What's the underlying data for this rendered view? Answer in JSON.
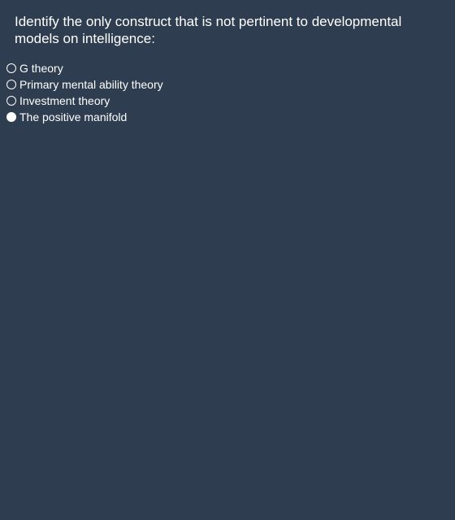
{
  "question": {
    "text": "Identify the only construct that is not pertinent to developmental models on intelligence:"
  },
  "options": [
    {
      "label": "G theory",
      "selected": false
    },
    {
      "label": "Primary mental ability theory",
      "selected": false
    },
    {
      "label": "Investment theory",
      "selected": false
    },
    {
      "label": "The positive manifold",
      "selected": true
    }
  ]
}
